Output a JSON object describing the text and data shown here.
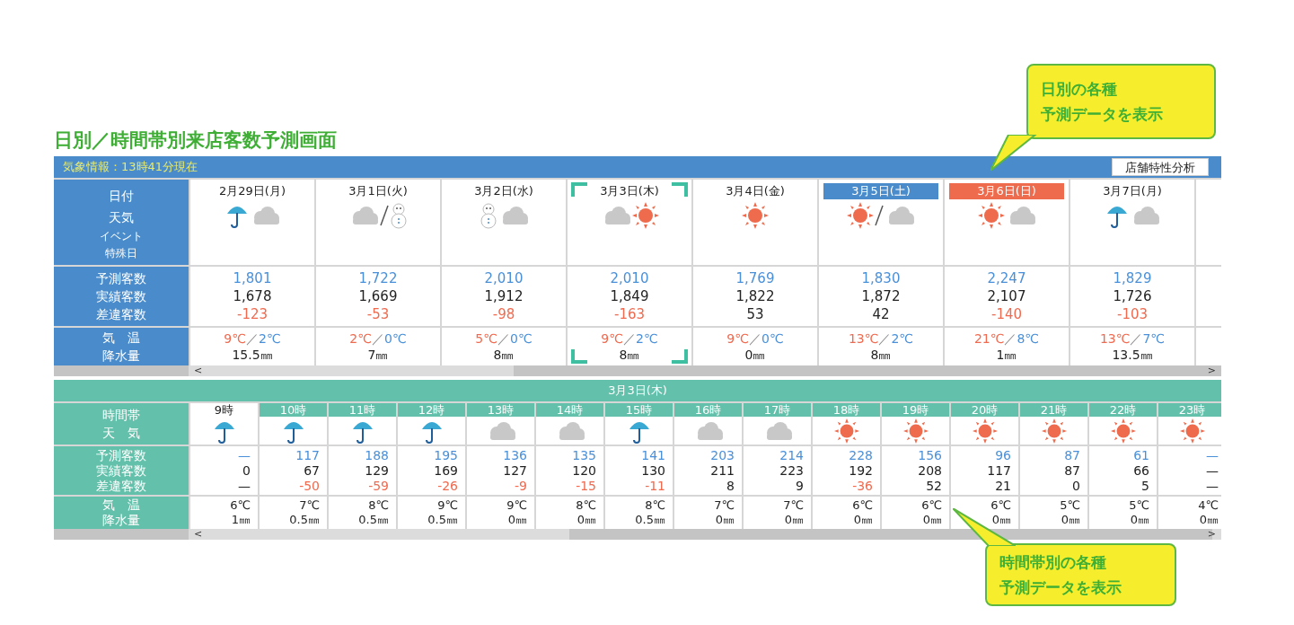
{
  "callouts": [
    {
      "lines": [
        "日別の各種",
        "予測データを表示"
      ],
      "kind": "top"
    },
    {
      "lines": [
        "時間帯別の各種",
        "予測データを表示"
      ],
      "kind": "bottom"
    }
  ],
  "title": "日別／時間帯別来店客数予測画面",
  "weather_bar": {
    "text": "気象情報：13時41分現在",
    "button": "店舗特性分析"
  },
  "daily": {
    "labels": {
      "top": [
        "日付",
        "天気",
        "イベント",
        "特殊日"
      ],
      "counts": [
        "予測客数",
        "実績客数",
        "差違客数"
      ],
      "climate": [
        "気　温",
        "降水量"
      ]
    },
    "days": [
      {
        "date": "2月29日(月)",
        "selected": false,
        "weather": [
          {
            "kind": "umbrella"
          },
          {
            "kind": "cloud"
          }
        ],
        "forecast": "1,801",
        "actual": "1,678",
        "diff": "-123",
        "alert": true,
        "high": "9℃",
        "sep": "／",
        "low": "2℃",
        "precip": "15.5㎜"
      },
      {
        "date": "3月1日(火)",
        "selected": false,
        "weather": [
          {
            "kind": "cloud"
          },
          {
            "kind": "slash"
          },
          {
            "kind": "snowman"
          }
        ],
        "forecast": "1,722",
        "actual": "1,669",
        "diff": "-53",
        "alert": true,
        "high": "2℃",
        "sep": "／",
        "low": "0℃",
        "precip": "7㎜"
      },
      {
        "date": "3月2日(水)",
        "selected": false,
        "weather": [
          {
            "kind": "snowman"
          },
          {
            "kind": "cloud"
          }
        ],
        "forecast": "2,010",
        "actual": "1,912",
        "diff": "-98",
        "alert": true,
        "high": "5℃",
        "sep": "／",
        "low": "0℃",
        "precip": "8㎜"
      },
      {
        "date": "3月3日(木)",
        "selected": true,
        "weather": [
          {
            "kind": "cloud"
          },
          {
            "kind": "sun"
          }
        ],
        "forecast": "2,010",
        "actual": "1,849",
        "diff": "-163",
        "alert": true,
        "high": "9℃",
        "sep": "／",
        "low": "2℃",
        "precip": "8㎜"
      },
      {
        "date": "3月4日(金)",
        "selected": false,
        "weather": [
          {
            "kind": "sun"
          }
        ],
        "forecast": "1,769",
        "actual": "1,822",
        "diff": "53",
        "alert": false,
        "high": "9℃",
        "sep": "／",
        "low": "0℃",
        "precip": "0㎜"
      },
      {
        "date": "3月5日(土)",
        "selected": false,
        "color": "#4a8ccb",
        "weather": [
          {
            "kind": "sun"
          },
          {
            "kind": "slash"
          },
          {
            "kind": "cloud"
          }
        ],
        "forecast": "1,830",
        "actual": "1,872",
        "diff": "42",
        "alert": false,
        "high": "13℃",
        "sep": "／",
        "low": "2℃",
        "precip": "8㎜"
      },
      {
        "date": "3月6日(日)",
        "selected": false,
        "color": "#ee6b4d",
        "weather": [
          {
            "kind": "sun"
          },
          {
            "kind": "cloud"
          }
        ],
        "forecast": "2,247",
        "actual": "2,107",
        "diff": "-140",
        "alert": true,
        "high": "21℃",
        "sep": "／",
        "low": "8℃",
        "precip": "1㎜"
      },
      {
        "date": "3月7日(月)",
        "selected": false,
        "weather": [
          {
            "kind": "umbrella"
          },
          {
            "kind": "cloud"
          }
        ],
        "forecast": "1,829",
        "actual": "1,726",
        "diff": "-103",
        "alert": true,
        "high": "13℃",
        "sep": "／",
        "low": "7℃",
        "precip": "13.5㎜"
      }
    ],
    "scroll_left": "<",
    "scroll_right": ">"
  },
  "hourly": {
    "title": "3月3日(木)",
    "labels": {
      "top": [
        "時間帯",
        "天　気"
      ],
      "counts": [
        "予測客数",
        "実績客数",
        "差違客数"
      ],
      "climate": [
        "気　温",
        "降水量"
      ]
    },
    "hours": [
      {
        "hour": "9時",
        "selected": true,
        "weather": {
          "kind": "umbrella"
        },
        "forecast": "—",
        "actual": "0",
        "diff": "—",
        "alert": false,
        "temp": "6℃",
        "precip": "1㎜"
      },
      {
        "hour": "10時",
        "selected": false,
        "weather": {
          "kind": "umbrella"
        },
        "forecast": "117",
        "actual": "67",
        "diff": "-50",
        "alert": true,
        "temp": "7℃",
        "precip": "0.5㎜"
      },
      {
        "hour": "11時",
        "selected": false,
        "weather": {
          "kind": "umbrella"
        },
        "forecast": "188",
        "actual": "129",
        "diff": "-59",
        "alert": true,
        "temp": "8℃",
        "precip": "0.5㎜"
      },
      {
        "hour": "12時",
        "selected": false,
        "weather": {
          "kind": "umbrella"
        },
        "forecast": "195",
        "actual": "169",
        "diff": "-26",
        "alert": true,
        "temp": "9℃",
        "precip": "0.5㎜"
      },
      {
        "hour": "13時",
        "selected": false,
        "weather": {
          "kind": "cloud"
        },
        "forecast": "136",
        "actual": "127",
        "diff": "-9",
        "alert": true,
        "temp": "9℃",
        "precip": "0㎜"
      },
      {
        "hour": "14時",
        "selected": false,
        "weather": {
          "kind": "cloud"
        },
        "forecast": "135",
        "actual": "120",
        "diff": "-15",
        "alert": true,
        "temp": "8℃",
        "precip": "0㎜"
      },
      {
        "hour": "15時",
        "selected": false,
        "weather": {
          "kind": "umbrella"
        },
        "forecast": "141",
        "actual": "130",
        "diff": "-11",
        "alert": true,
        "temp": "8℃",
        "precip": "0.5㎜"
      },
      {
        "hour": "16時",
        "selected": false,
        "weather": {
          "kind": "cloud"
        },
        "forecast": "203",
        "actual": "211",
        "diff": "8",
        "alert": false,
        "temp": "7℃",
        "precip": "0㎜"
      },
      {
        "hour": "17時",
        "selected": false,
        "weather": {
          "kind": "cloud"
        },
        "forecast": "214",
        "actual": "223",
        "diff": "9",
        "alert": false,
        "temp": "7℃",
        "precip": "0㎜"
      },
      {
        "hour": "18時",
        "selected": false,
        "weather": {
          "kind": "sun"
        },
        "forecast": "228",
        "actual": "192",
        "diff": "-36",
        "alert": true,
        "temp": "6℃",
        "precip": "0㎜"
      },
      {
        "hour": "19時",
        "selected": false,
        "weather": {
          "kind": "sun"
        },
        "forecast": "156",
        "actual": "208",
        "diff": "52",
        "alert": false,
        "temp": "6℃",
        "precip": "0㎜"
      },
      {
        "hour": "20時",
        "selected": false,
        "weather": {
          "kind": "sun"
        },
        "forecast": "96",
        "actual": "117",
        "diff": "21",
        "alert": false,
        "temp": "6℃",
        "precip": "0㎜"
      },
      {
        "hour": "21時",
        "selected": false,
        "weather": {
          "kind": "sun"
        },
        "forecast": "87",
        "actual": "87",
        "diff": "0",
        "alert": false,
        "temp": "5℃",
        "precip": "0㎜"
      },
      {
        "hour": "22時",
        "selected": false,
        "weather": {
          "kind": "sun"
        },
        "forecast": "61",
        "actual": "66",
        "diff": "5",
        "alert": false,
        "temp": "5℃",
        "precip": "0㎜"
      },
      {
        "hour": "23時",
        "selected": false,
        "weather": {
          "kind": "sun"
        },
        "forecast": "—",
        "actual": "—",
        "diff": "—",
        "alert": false,
        "temp": "4℃",
        "precip": "0㎜"
      }
    ],
    "scroll_left": "<",
    "scroll_right": ">"
  }
}
